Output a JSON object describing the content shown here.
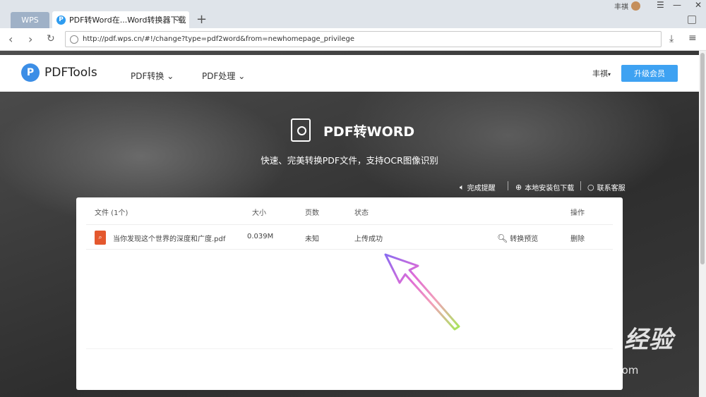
{
  "browser": {
    "tabs": [
      {
        "label": "WPS"
      },
      {
        "label": "PDF转Word在...Word转换器下载"
      }
    ],
    "window_user": "丰祺",
    "url": "http://pdf.wps.cn/#!/change?type=pdf2word&from=newhomepage_privilege"
  },
  "header": {
    "logo_mark": "P",
    "logo_text": "PDFTools",
    "nav": [
      {
        "label": "PDF转换"
      },
      {
        "label": "PDF处理"
      }
    ],
    "user": "丰祺",
    "upgrade_label": "升级会员"
  },
  "hero": {
    "title": "PDF转WORD",
    "subtitle": "快速、完美转换PDF文件，支持OCR图像识别"
  },
  "links": [
    {
      "label": "完成提醒"
    },
    {
      "label": "本地安装包下载"
    },
    {
      "label": "联系客服"
    }
  ],
  "table": {
    "headers": {
      "file": "文件 (1个)",
      "size": "大小",
      "pages": "页数",
      "status": "状态",
      "ops": "操作"
    },
    "rows": [
      {
        "name": "当你发现这个世界的深度和广度.pdf",
        "size": "0.039M",
        "pages": "未知",
        "status": "上传成功",
        "preview": "转换预览",
        "delete": "删除"
      }
    ]
  },
  "watermark": {
    "brand": "Baidu经验",
    "url": "jingyan.baidu.com"
  },
  "colors": {
    "accent": "#3ea2f2",
    "file_icon": "#e4582e"
  }
}
